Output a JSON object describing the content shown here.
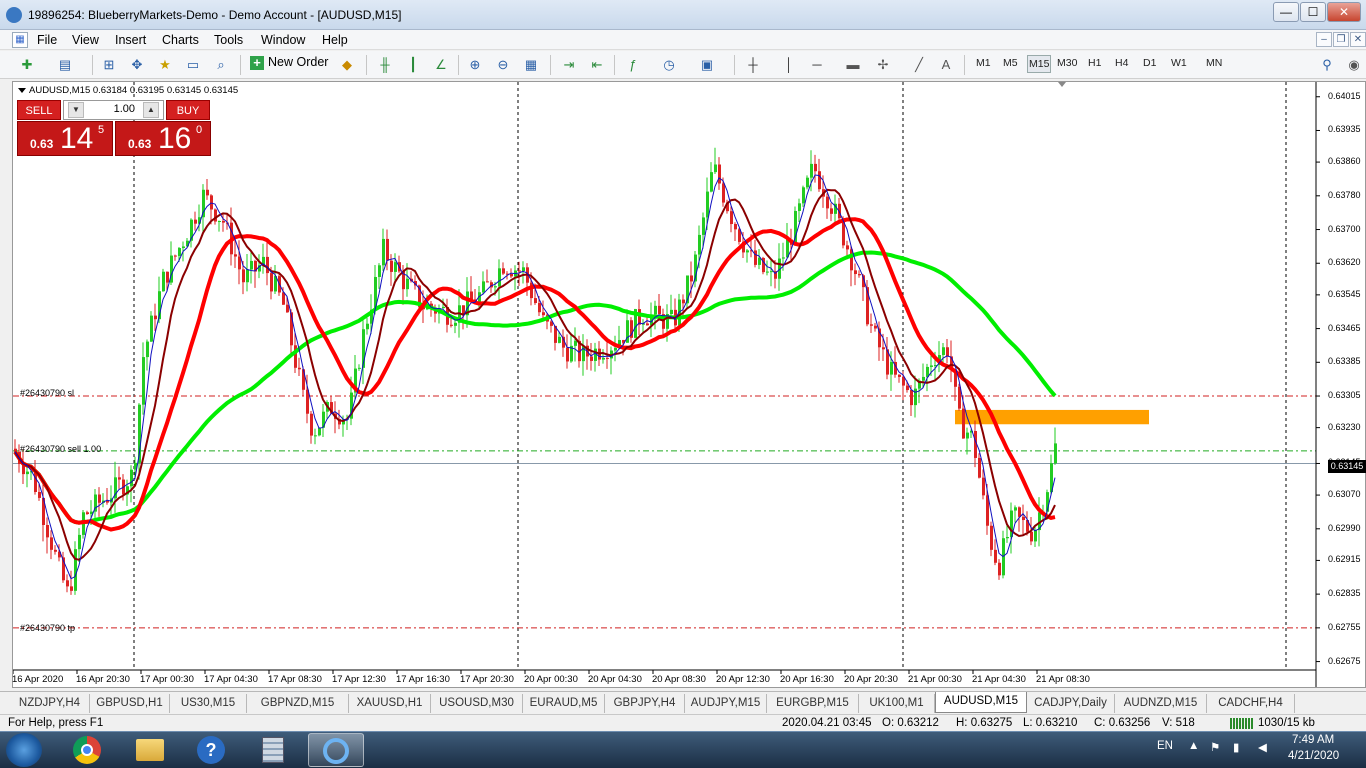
{
  "window": {
    "title": "19896254: BlueberryMarkets-Demo - Demo Account - [AUDUSD,M15]",
    "minimize": "—",
    "maximize": "☐",
    "close": "✕"
  },
  "menu": {
    "items": [
      "File",
      "View",
      "Insert",
      "Charts",
      "Tools",
      "Window",
      "Help"
    ]
  },
  "toolbar": {
    "new_order": "New Order",
    "timeframes": [
      "M1",
      "M5",
      "M15",
      "M30",
      "H1",
      "H4",
      "D1",
      "W1",
      "MN"
    ],
    "active_timeframe": "M15"
  },
  "chart": {
    "symbol_header": "AUDUSD,M15  0.63184 0.63195 0.63145 0.63145",
    "one_click": {
      "sell_label": "SELL",
      "buy_label": "BUY",
      "volume": "1.00",
      "sell_prefix": "0.63",
      "sell_big": "14",
      "sell_sup": "5",
      "buy_prefix": "0.63",
      "buy_big": "16",
      "buy_sup": "0"
    },
    "current_price": "0.63145",
    "order_labels": {
      "sl": "#26430790 sl",
      "entry": "#26430790 sell 1.00",
      "tp": "#26430790 tp"
    }
  },
  "chart_data": {
    "type": "candlestick",
    "symbol": "AUDUSD",
    "timeframe": "M15",
    "price_axis": [
      "0.64015",
      "0.63935",
      "0.63860",
      "0.63780",
      "0.63700",
      "0.63620",
      "0.63545",
      "0.63465",
      "0.63385",
      "0.63305",
      "0.63230",
      "0.63145",
      "0.63070",
      "0.62990",
      "0.62915",
      "0.62835",
      "0.62755",
      "0.62675"
    ],
    "time_axis": [
      "16 Apr 2020",
      "16 Apr 20:30",
      "17 Apr 00:30",
      "17 Apr 04:30",
      "17 Apr 08:30",
      "17 Apr 12:30",
      "17 Apr 16:30",
      "17 Apr 20:30",
      "20 Apr 00:30",
      "20 Apr 04:30",
      "20 Apr 08:30",
      "20 Apr 12:30",
      "20 Apr 16:30",
      "20 Apr 20:30",
      "21 Apr 00:30",
      "21 Apr 04:30",
      "21 Apr 08:30"
    ],
    "ylim": [
      0.62655,
      0.6405
    ],
    "levels": {
      "sl": 0.63305,
      "entry": 0.63175,
      "tp": 0.62755,
      "bid": 0.63145
    },
    "ma_colors": {
      "fast": "#1010c0",
      "medium": "#8b0000",
      "slow": "#ff0000",
      "long": "#00ee00"
    },
    "candle_colors": {
      "up": "#22cc22",
      "down": "#dd2222"
    },
    "zone_color": "#ffa000"
  },
  "tabs": [
    "NZDJPY,H4",
    "GBPUSD,H1",
    "US30,M15",
    "GBPNZD,M15",
    "XAUUSD,H1",
    "USOUSD,M30",
    "EURAUD,M5",
    "GBPJPY,H4",
    "AUDJPY,M15",
    "EURGBP,M15",
    "UK100,M1",
    "AUDUSD,M15",
    "CADJPY,Daily",
    "AUDNZD,M15",
    "CADCHF,H4"
  ],
  "active_tab": "AUDUSD,M15",
  "status": {
    "help": "For Help, press F1",
    "datetime": "2020.04.21 03:45",
    "open": "O: 0.63212",
    "high": "H: 0.63275",
    "low": "L: 0.63210",
    "close": "C: 0.63256",
    "volume": "V: 518",
    "traffic": "1030/15 kb"
  },
  "taskbar": {
    "lang": "EN",
    "time": "7:49 AM",
    "date": "4/21/2020"
  }
}
